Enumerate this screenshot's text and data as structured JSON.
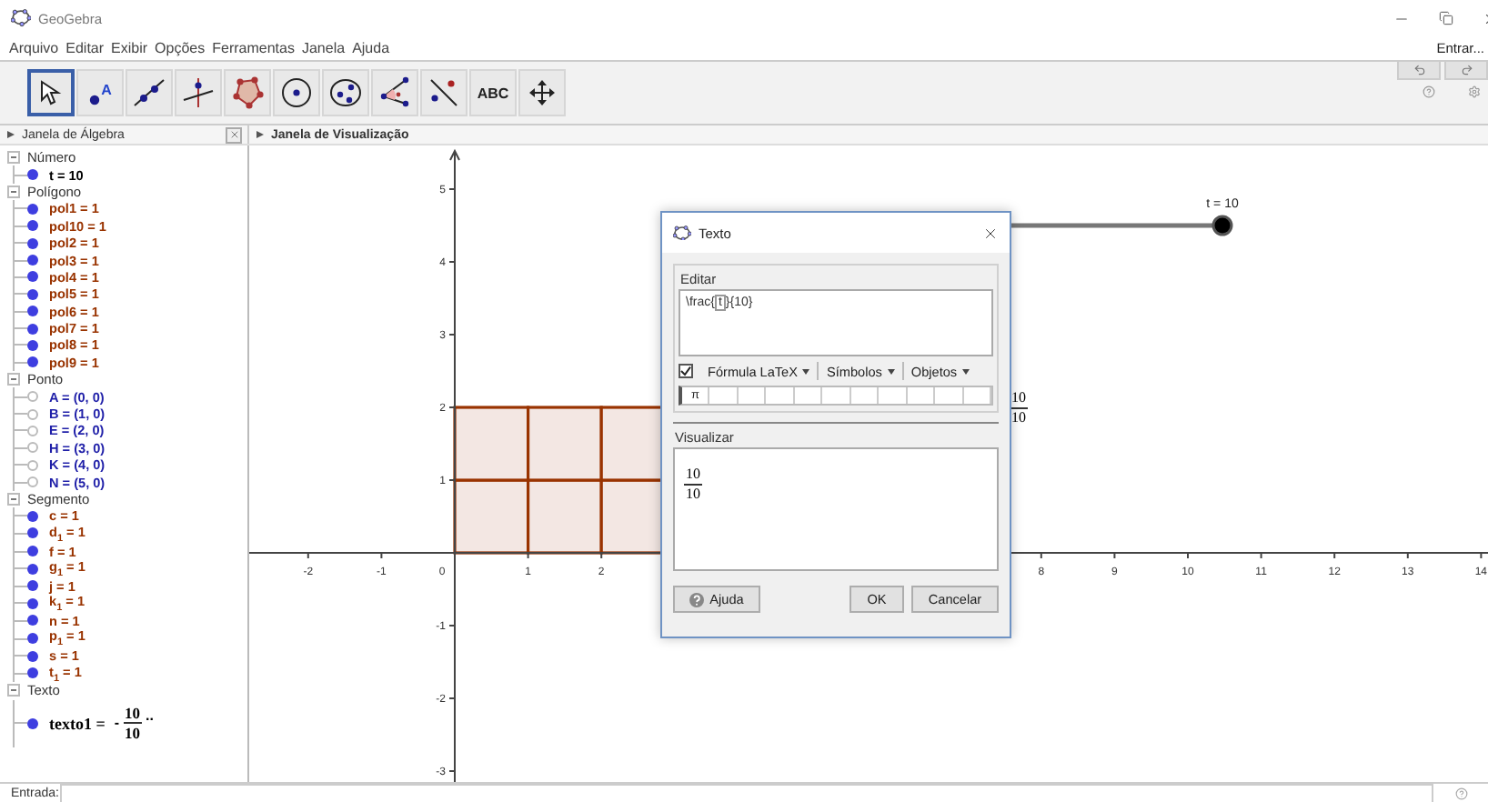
{
  "window": {
    "title": "GeoGebra"
  },
  "menu": [
    "Arquivo",
    "Editar",
    "Exibir",
    "Opções",
    "Ferramentas",
    "Janela",
    "Ajuda"
  ],
  "signin": "Entrar...",
  "tools": [
    {
      "kind": "move",
      "selected": true
    },
    {
      "kind": "point",
      "glyph": "A",
      "selected": false
    },
    {
      "kind": "line",
      "selected": false
    },
    {
      "kind": "perpendicular",
      "selected": false
    },
    {
      "kind": "polygon",
      "selected": false
    },
    {
      "kind": "circle",
      "selected": false
    },
    {
      "kind": "conic",
      "selected": false
    },
    {
      "kind": "angle",
      "selected": false
    },
    {
      "kind": "reflect",
      "selected": false
    },
    {
      "kind": "text",
      "glyph": "ABC",
      "selected": false
    },
    {
      "kind": "pan",
      "selected": false
    }
  ],
  "algebra": {
    "title": "Janela de Álgebra",
    "groups": [
      {
        "name": "Número",
        "expanded": true,
        "items": [
          {
            "text": "t = 10",
            "visible": true,
            "color": "#000000"
          }
        ]
      },
      {
        "name": "Polígono",
        "expanded": true,
        "items": [
          {
            "text": "pol1 = 1",
            "visible": true,
            "color": "#993300"
          },
          {
            "text": "pol10 = 1",
            "visible": true,
            "color": "#993300"
          },
          {
            "text": "pol2 = 1",
            "visible": true,
            "color": "#993300"
          },
          {
            "text": "pol3 = 1",
            "visible": true,
            "color": "#993300"
          },
          {
            "text": "pol4 = 1",
            "visible": true,
            "color": "#993300"
          },
          {
            "text": "pol5 = 1",
            "visible": true,
            "color": "#993300"
          },
          {
            "text": "pol6 = 1",
            "visible": true,
            "color": "#993300"
          },
          {
            "text": "pol7 = 1",
            "visible": true,
            "color": "#993300"
          },
          {
            "text": "pol8 = 1",
            "visible": true,
            "color": "#993300"
          },
          {
            "text": "pol9 = 1",
            "visible": true,
            "color": "#993300"
          }
        ]
      },
      {
        "name": "Ponto",
        "expanded": true,
        "items": [
          {
            "text": "A = (0, 0)",
            "visible": false,
            "color": "#1f1fa8"
          },
          {
            "text": "B = (1, 0)",
            "visible": false,
            "color": "#1f1fa8"
          },
          {
            "text": "E = (2, 0)",
            "visible": false,
            "color": "#1f1fa8"
          },
          {
            "text": "H = (3, 0)",
            "visible": false,
            "color": "#1f1fa8"
          },
          {
            "text": "K = (4, 0)",
            "visible": false,
            "color": "#1f1fa8"
          },
          {
            "text": "N = (5, 0)",
            "visible": false,
            "color": "#1f1fa8"
          }
        ]
      },
      {
        "name": "Segmento",
        "expanded": true,
        "items": [
          {
            "text": "c = 1",
            "visible": true,
            "color": "#993300"
          },
          {
            "text": "d$_{1}$ = 1",
            "visible": true,
            "color": "#993300"
          },
          {
            "text": "f = 1",
            "visible": true,
            "color": "#993300"
          },
          {
            "text": "g$_{1}$ = 1",
            "visible": true,
            "color": "#993300"
          },
          {
            "text": "j = 1",
            "visible": true,
            "color": "#993300"
          },
          {
            "text": "k$_{1}$ = 1",
            "visible": true,
            "color": "#993300"
          },
          {
            "text": "n = 1",
            "visible": true,
            "color": "#993300"
          },
          {
            "text": "p$_{1}$ = 1",
            "visible": true,
            "color": "#993300"
          },
          {
            "text": "s = 1",
            "visible": true,
            "color": "#993300"
          },
          {
            "text": "t$_{1}$ = 1",
            "visible": true,
            "color": "#993300"
          }
        ]
      },
      {
        "name": "Texto",
        "expanded": true,
        "items": [
          {
            "kind": "latex",
            "label": "texto1 =",
            "prefix": "-",
            "numerator": "10",
            "denominator": "10",
            "suffix": "..",
            "visible": true,
            "color": "#000000"
          }
        ]
      }
    ]
  },
  "graphics": {
    "title": "Janela de Visualização",
    "x_labels": [
      "-2",
      "-1",
      "0",
      "1",
      "2",
      "8",
      "9",
      "10",
      "11",
      "12",
      "13",
      "14"
    ],
    "y_labels": [
      "5",
      "4",
      "3",
      "2",
      "1",
      "-1",
      "-2",
      "-3"
    ],
    "slider": {
      "label": "t = 10"
    },
    "text_object": {
      "numerator": "10",
      "denominator": "10"
    }
  },
  "dialog": {
    "title": "Texto",
    "edit_label": "Editar",
    "editor": {
      "before": "\\frac{",
      "object": "t",
      "after": "}{10}"
    },
    "latex": {
      "label": "Fórmula LaTeX",
      "checked": true
    },
    "menus": [
      "Símbolos",
      "Objetos"
    ],
    "symbols": [
      "π"
    ],
    "preview_label": "Visualizar",
    "preview": {
      "numerator": "10",
      "denominator": "10"
    },
    "buttons": [
      {
        "kind": "help",
        "label": "Ajuda"
      },
      {
        "kind": "ok",
        "label": "OK"
      },
      {
        "kind": "cancel",
        "label": "Cancelar"
      }
    ]
  },
  "input_bar": {
    "label": "Entrada:"
  }
}
